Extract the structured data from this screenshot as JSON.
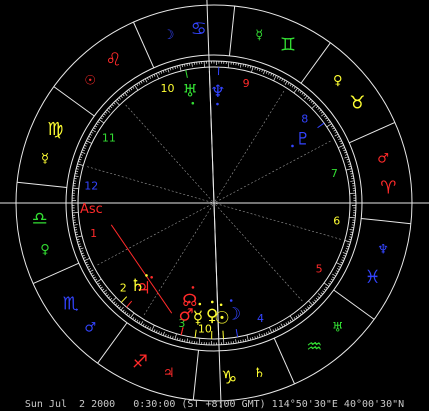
{
  "colors": {
    "background": "#000000",
    "ring": "#e8e8e8",
    "fire": "#ff2a2a",
    "earth": "#ffff33",
    "air": "#33dd33",
    "water": "#3344ff",
    "ascendant": "#ff2a2a"
  },
  "signs": [
    {
      "name": "Aries",
      "icon": "aries-icon",
      "glyph": "♈",
      "element": "fire",
      "ruler": "♂",
      "ruler_color": "fire"
    },
    {
      "name": "Taurus",
      "icon": "taurus-icon",
      "glyph": "♉",
      "element": "earth",
      "ruler": "♀",
      "ruler_color": "earth"
    },
    {
      "name": "Gemini",
      "icon": "gemini-icon",
      "glyph": "♊",
      "element": "air",
      "ruler": "☿",
      "ruler_color": "air"
    },
    {
      "name": "Cancer",
      "icon": "cancer-icon",
      "glyph": "♋",
      "element": "water",
      "ruler": "☽",
      "ruler_color": "water"
    },
    {
      "name": "Leo",
      "icon": "leo-icon",
      "glyph": "♌",
      "element": "fire",
      "ruler": "☉",
      "ruler_color": "fire"
    },
    {
      "name": "Virgo",
      "icon": "virgo-icon",
      "glyph": "♍",
      "element": "earth",
      "ruler": "☿",
      "ruler_color": "earth"
    },
    {
      "name": "Libra",
      "icon": "libra-icon",
      "glyph": "♎",
      "element": "air",
      "ruler": "♀",
      "ruler_color": "air"
    },
    {
      "name": "Scorpio",
      "icon": "scorpio-icon",
      "glyph": "♏",
      "element": "water",
      "ruler": "♂",
      "ruler_color": "water"
    },
    {
      "name": "Sagittarius",
      "icon": "sagittarius-icon",
      "glyph": "♐",
      "element": "fire",
      "ruler": "♃",
      "ruler_color": "fire"
    },
    {
      "name": "Capricorn",
      "icon": "capricorn-icon",
      "glyph": "♑",
      "element": "earth",
      "ruler": "♄",
      "ruler_color": "earth"
    },
    {
      "name": "Aquarius",
      "icon": "aquarius-icon",
      "glyph": "♒",
      "element": "air",
      "ruler": "♅",
      "ruler_color": "air"
    },
    {
      "name": "Pisces",
      "icon": "pisces-icon",
      "glyph": "♓",
      "element": "water",
      "ruler": "♆",
      "ruler_color": "water"
    }
  ],
  "houses": [
    {
      "num": "1",
      "color": "fire"
    },
    {
      "num": "2",
      "color": "earth"
    },
    {
      "num": "3",
      "color": "air"
    },
    {
      "num": "4",
      "color": "water"
    },
    {
      "num": "5",
      "color": "fire"
    },
    {
      "num": "6",
      "color": "earth"
    },
    {
      "num": "7",
      "color": "air"
    },
    {
      "num": "8",
      "color": "water"
    },
    {
      "num": "9",
      "color": "fire"
    },
    {
      "num": "10",
      "color": "earth"
    },
    {
      "num": "11",
      "color": "air"
    },
    {
      "num": "12",
      "color": "water"
    }
  ],
  "ascendant_label": "Asc",
  "mc_label": "10",
  "planets": [
    {
      "name": "Sun",
      "icon": "sun-icon",
      "glyph": "☉",
      "color": "earth"
    },
    {
      "name": "Moon",
      "icon": "moon-icon",
      "glyph": "☽",
      "color": "water"
    },
    {
      "name": "Mercury",
      "icon": "mercury-icon",
      "glyph": "☿",
      "color": "earth"
    },
    {
      "name": "Venus",
      "icon": "venus-icon",
      "glyph": "♀",
      "color": "earth"
    },
    {
      "name": "Mars",
      "icon": "mars-icon",
      "glyph": "♂",
      "color": "fire"
    },
    {
      "name": "Jupiter",
      "icon": "jupiter-icon",
      "glyph": "♃",
      "color": "fire"
    },
    {
      "name": "Saturn",
      "icon": "saturn-icon",
      "glyph": "♄",
      "color": "earth"
    },
    {
      "name": "Uranus",
      "icon": "uranus-icon",
      "glyph": "♅",
      "color": "air"
    },
    {
      "name": "Neptune",
      "icon": "neptune-icon",
      "glyph": "♆",
      "color": "water"
    },
    {
      "name": "Pluto",
      "icon": "pluto-icon",
      "glyph": "♇",
      "color": "water"
    },
    {
      "name": "Node",
      "icon": "node-icon",
      "glyph": "☊",
      "color": "fire"
    }
  ],
  "footer": "Sun Jul  2 2000   0:30:00 (ST +8:00 GMT) 114°50'30\"E 40°00'30\"N"
}
